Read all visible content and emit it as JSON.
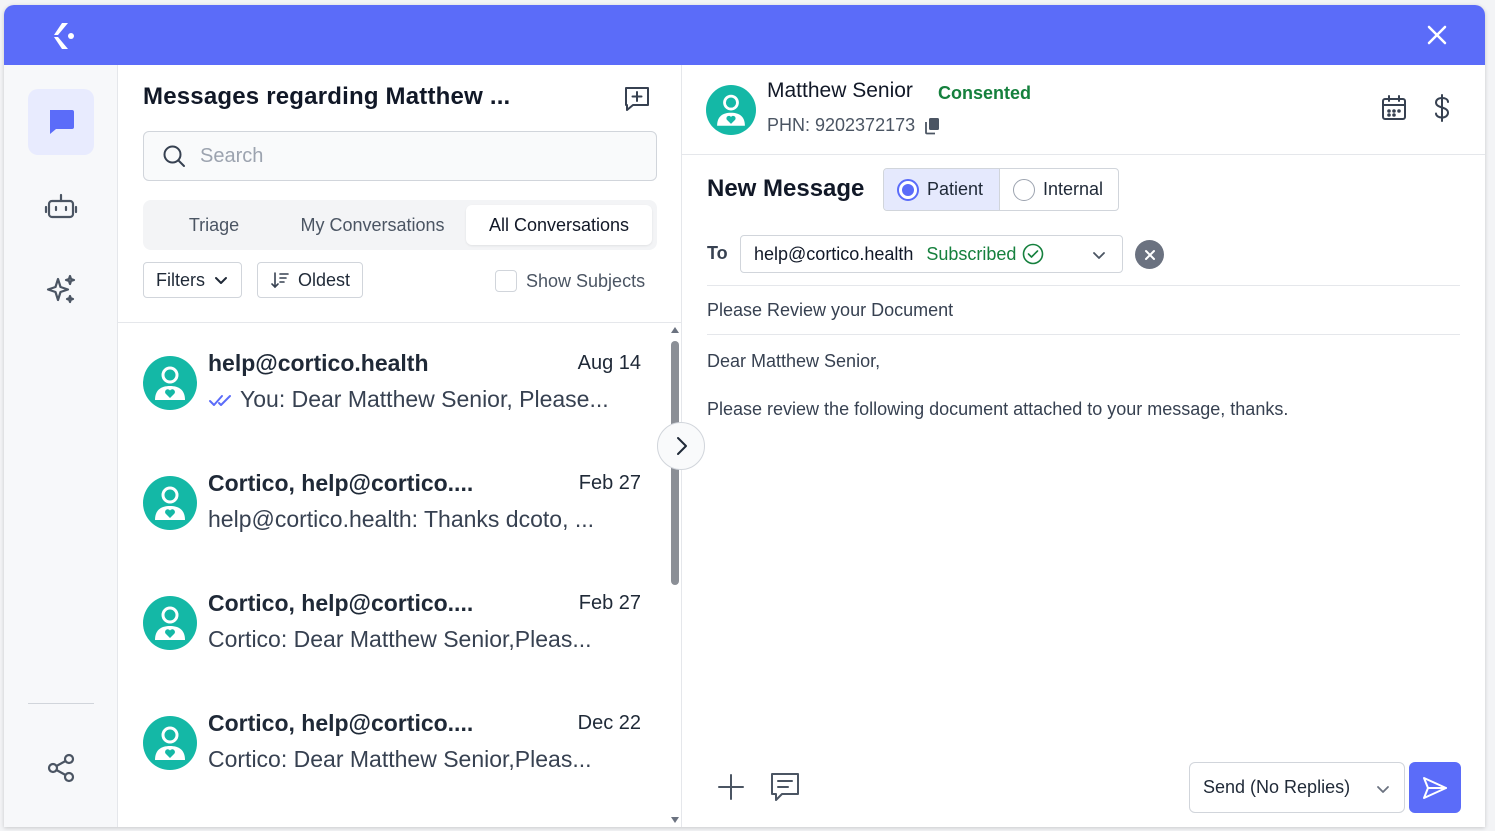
{
  "app": {
    "colors": {
      "brand": "#5b6cf9",
      "teal_avatar": "#14b8a6",
      "success": "#15803d"
    },
    "icons": {
      "logo": "cortico-logo-icon",
      "close": "close-icon"
    }
  },
  "rail": {
    "items": [
      {
        "name": "messages",
        "icon": "chat-bubble-icon",
        "active": true
      },
      {
        "name": "bot",
        "icon": "robot-icon",
        "active": false
      },
      {
        "name": "ai",
        "icon": "sparkles-icon",
        "active": false
      },
      {
        "name": "share",
        "icon": "share-icon",
        "active": false
      }
    ]
  },
  "list": {
    "title": "Messages regarding Matthew ...",
    "new_icon": "new-conversation-icon",
    "search_placeholder": "Search",
    "tabs": [
      {
        "label": "Triage",
        "active": false
      },
      {
        "label": "My Conversations",
        "active": false
      },
      {
        "label": "All Conversations",
        "active": true
      }
    ],
    "filters_label": "Filters",
    "sort_label": "Oldest",
    "show_subjects_label": "Show Subjects",
    "conversations": [
      {
        "name": "help@cortico.health",
        "date": "Aug 14",
        "preview": "You: Dear Matthew Senior, Please...",
        "read_receipt": true
      },
      {
        "name": "Cortico, help@cortico....",
        "date": "Feb 27",
        "preview": "help@cortico.health: Thanks dcoto, ...",
        "read_receipt": false
      },
      {
        "name": "Cortico, help@cortico....",
        "date": "Feb 27",
        "preview": "Cortico: Dear Matthew Senior,Pleas...",
        "read_receipt": false
      },
      {
        "name": "Cortico, help@cortico....",
        "date": "Dec 22",
        "preview": "Cortico: Dear Matthew Senior,Pleas...",
        "read_receipt": false
      }
    ]
  },
  "patient": {
    "name": "Matthew Senior",
    "status": "Consented",
    "phn": "PHN: 9202372173",
    "icons": {
      "copy": "copy-icon",
      "calendar": "calendar-icon",
      "billing": "dollar-icon"
    }
  },
  "composer": {
    "title": "New Message",
    "recipient_types": [
      {
        "label": "Patient",
        "selected": true
      },
      {
        "label": "Internal",
        "selected": false
      }
    ],
    "to_label": "To",
    "to_value": "help@cortico.health",
    "to_status": "Subscribed",
    "subject": "Please Review your Document",
    "body_greeting": "Dear Matthew Senior,",
    "body_text": "Please review the following document attached to your message, thanks.",
    "send_mode": "Send (No Replies)"
  }
}
